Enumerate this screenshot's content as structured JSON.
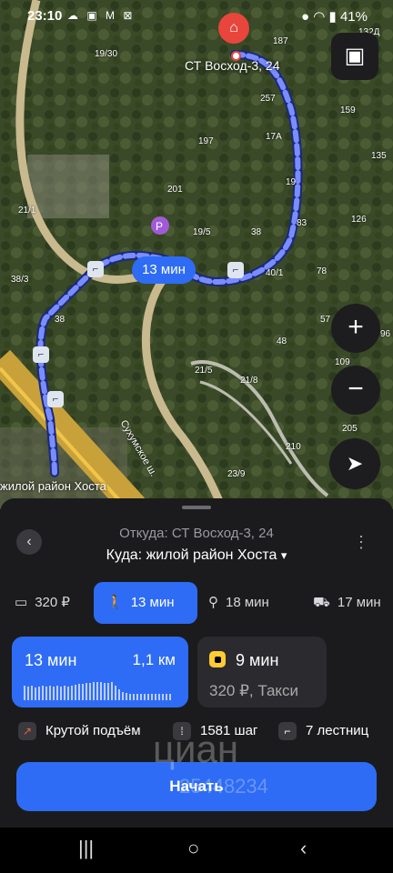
{
  "status_bar": {
    "time": "23:10",
    "icons": "☁ ▣ M ⊠",
    "battery": "41%"
  },
  "map": {
    "destination_label": "СТ Восход-3, 24",
    "route_time": "13 мин",
    "area_label": "жилой район Хоста",
    "street_label": "Сухумское ш.",
    "house_numbers": [
      "19/30",
      "197",
      "257",
      "17А",
      "159",
      "135",
      "201",
      "19",
      "83",
      "126",
      "21/1",
      "19/5",
      "38",
      "40/1",
      "78",
      "38/3",
      "38",
      "57",
      "96",
      "48",
      "109",
      "21/5",
      "21/8",
      "205",
      "210",
      "23/9",
      "187",
      "132Д"
    ],
    "zoom_in_label": "+",
    "zoom_out_label": "−"
  },
  "sheet": {
    "from_text": "Откуда: СТ Восход-3, 24",
    "to_text": "Куда: жилой район Хоста",
    "to_chevron": "▾",
    "modes": [
      {
        "label": "320 ₽",
        "icon": "car-icon"
      },
      {
        "label": "13 мин",
        "icon": "walk-icon",
        "active": true
      },
      {
        "label": "18 мин",
        "icon": "bike-icon"
      },
      {
        "label": "17 мин",
        "icon": "scooter-icon"
      }
    ],
    "walk_card": {
      "time": "13 мин",
      "distance": "1,1 км"
    },
    "taxi_card": {
      "time": "9 мин",
      "price": "320 ₽, Такси"
    },
    "facts": [
      {
        "text": "Крутой подъём",
        "color": "#e8633c"
      },
      {
        "text": "1581 шаг",
        "color": "#3a3a3e"
      },
      {
        "text": "7 лестниц",
        "color": "#3a3a3e"
      }
    ],
    "start_button": "Начать"
  },
  "watermark": {
    "brand": "циан",
    "number": "25448234"
  },
  "colors": {
    "accent": "#2e6cf5",
    "sheet_bg": "#1b1b1d",
    "pin": "#e8453c"
  }
}
